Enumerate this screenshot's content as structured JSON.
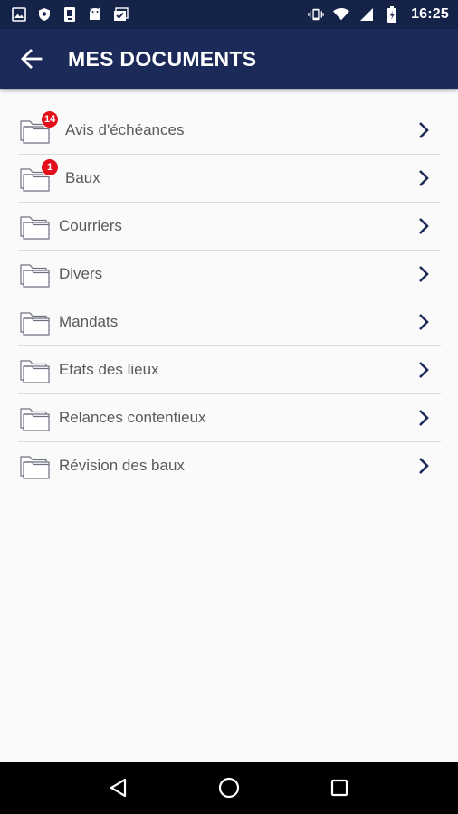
{
  "status_bar": {
    "time": "16:25",
    "left_icons": [
      "image-icon",
      "shield-icon",
      "phone-icon",
      "android-icon",
      "checklist-icon"
    ],
    "right_icons": [
      "vibrate-icon",
      "wifi-icon",
      "signal-icon",
      "battery-icon"
    ]
  },
  "header": {
    "title": "MES DOCUMENTS",
    "back_icon": "arrow-left-icon",
    "background": "#1b2a59"
  },
  "documents": {
    "items": [
      {
        "label": "Avis d'échéances",
        "badge": "14"
      },
      {
        "label": "Baux",
        "badge": "1"
      },
      {
        "label": "Courriers",
        "badge": ""
      },
      {
        "label": "Divers",
        "badge": ""
      },
      {
        "label": "Mandats",
        "badge": ""
      },
      {
        "label": "Etats des lieux",
        "badge": ""
      },
      {
        "label": "Relances contentieux",
        "badge": ""
      },
      {
        "label": "Révision des baux",
        "badge": ""
      }
    ],
    "badge_color": "#e3101c",
    "chevron_color": "#1b2a59"
  },
  "nav_bar": {
    "buttons": [
      "back-triangle-icon",
      "home-circle-icon",
      "recents-square-icon"
    ]
  }
}
